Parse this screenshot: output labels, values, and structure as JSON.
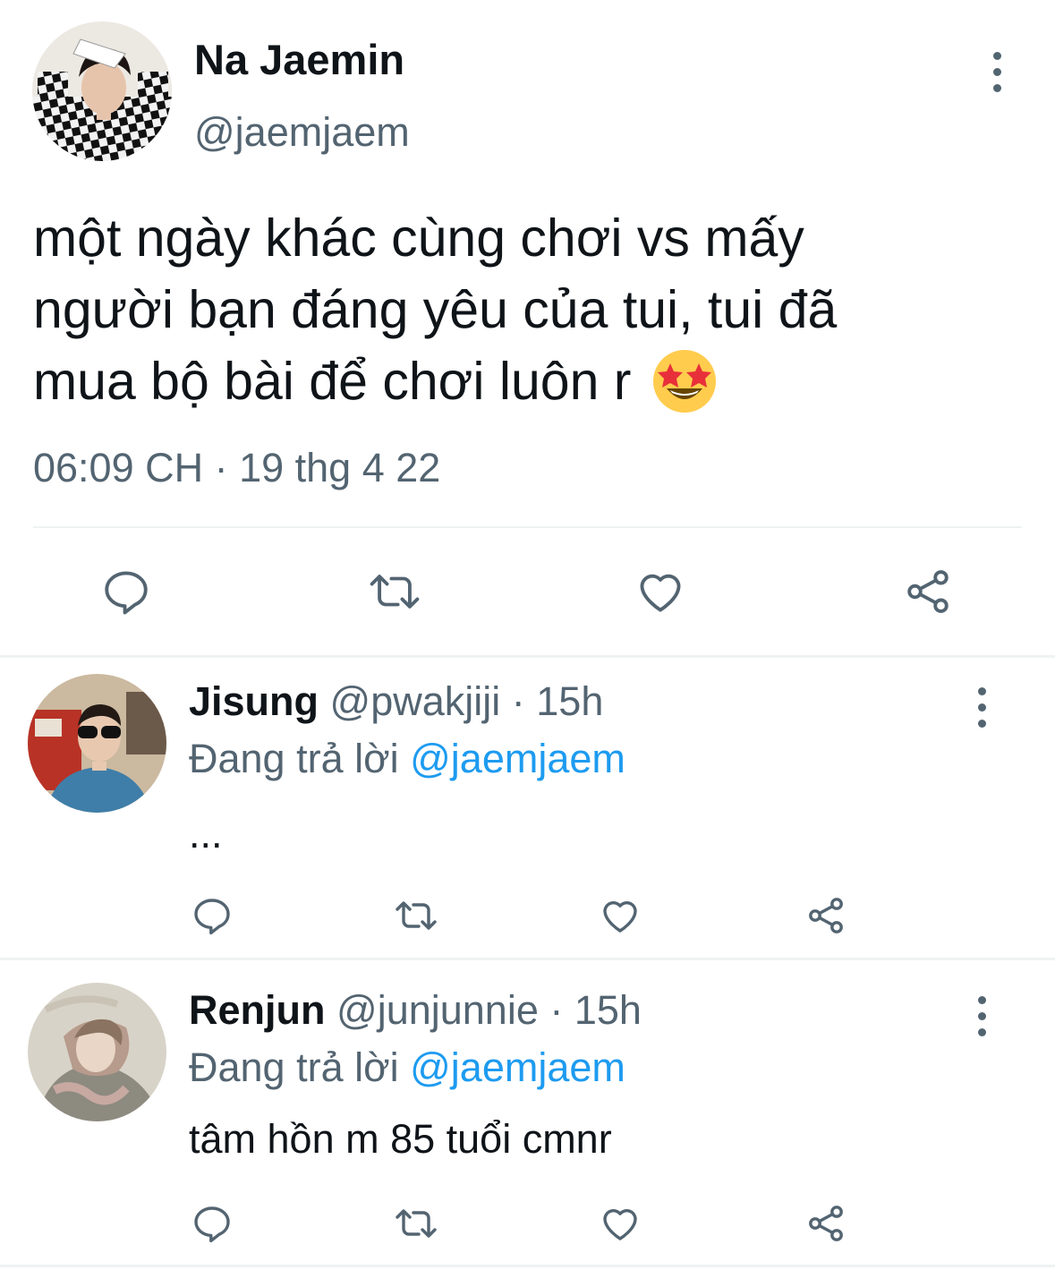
{
  "main_tweet": {
    "author_name": "Na Jaemin",
    "author_handle": "@jaemjaem",
    "text_line1": "một ngày khác cùng chơi vs mấy",
    "text_line2": "người bạn đáng yêu của tui, tui đã",
    "text_line3": "mua bộ bài để chơi luôn r",
    "emoji": "star-struck-emoji",
    "timestamp": "06:09 CH · 19 thg 4 22"
  },
  "replies": [
    {
      "author_name": "Jisung",
      "author_handle": "@pwakjiji",
      "time": "· 15h",
      "replying_prefix": "Đang trả lời",
      "replying_to": "@jaemjaem",
      "text": "..."
    },
    {
      "author_name": "Renjun",
      "author_handle": "@junjunnie",
      "time": "· 15h",
      "replying_prefix": "Đang trả lời",
      "replying_to": "@jaemjaem",
      "text": "tâm hồn m 85 tuổi cmnr"
    }
  ],
  "icons": {
    "reply": "reply-icon",
    "retweet": "retweet-icon",
    "like": "heart-icon",
    "share": "share-icon",
    "more": "more-vertical-icon"
  },
  "colors": {
    "text": "#0f1419",
    "secondary": "#536471",
    "link": "#1d9bf0",
    "divider": "#eff3f4"
  }
}
